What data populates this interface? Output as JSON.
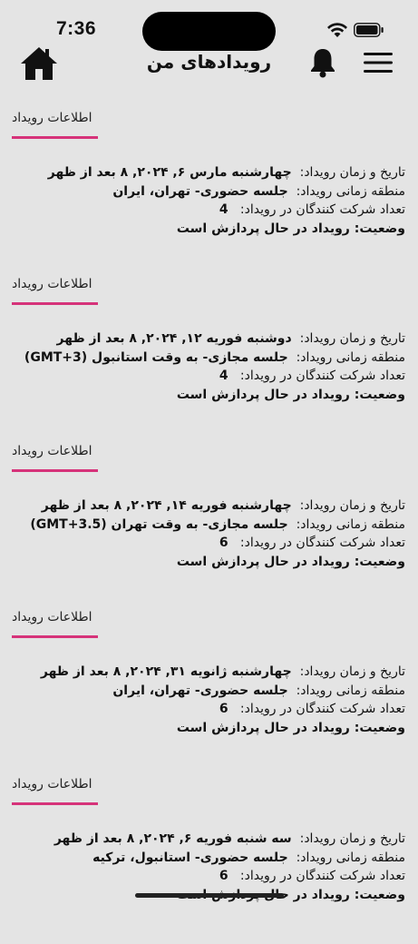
{
  "status_bar": {
    "time": "7:36"
  },
  "header": {
    "title": "رویدادهای من"
  },
  "labels": {
    "section_title": "اطلاعات رویداد",
    "datetime": "تاریخ و زمان رویداد:",
    "timezone": "منطقه زمانی رویداد:",
    "participants": "تعداد شرکت کنندگان در رویداد:"
  },
  "events": [
    {
      "datetime": "چهارشنبه مارس ۶, ۲۰۲۴, ۸ بعد از ظهر",
      "timezone": "جلسه حضوری- تهران، ایران",
      "participants": "4",
      "status": "وضعیت: رویداد در حال پردازش است"
    },
    {
      "datetime": "دوشنبه فوریه ۱۲, ۲۰۲۴, ۸ بعد از ظهر",
      "timezone": "جلسه مجازی- به وقت استانبول (GMT+3)",
      "participants": "4",
      "status": "وضعیت: رویداد در حال پردازش است"
    },
    {
      "datetime": "چهارشنبه فوریه ۱۴, ۲۰۲۴, ۸ بعد از ظهر",
      "timezone": "جلسه مجازی- به وقت تهران (GMT+3.5)",
      "participants": "6",
      "status": "وضعیت: رویداد در حال پردازش است"
    },
    {
      "datetime": "چهارشنبه ژانویه ۳۱, ۲۰۲۴, ۸ بعد از ظهر",
      "timezone": "جلسه حضوری- تهران، ایران",
      "participants": "6",
      "status": "وضعیت: رویداد در حال پردازش است"
    },
    {
      "datetime": "سه شنبه فوریه ۶, ۲۰۲۴, ۸ بعد از ظهر",
      "timezone": "جلسه حضوری- استانبول، ترکیه",
      "participants": "6",
      "status": "وضعیت: رویداد در حال پردازش است"
    }
  ],
  "icons": {
    "home": "home-icon",
    "bell": "bell-icon",
    "menu": "hamburger-menu-icon",
    "wifi": "wifi-icon",
    "battery": "battery-icon"
  }
}
